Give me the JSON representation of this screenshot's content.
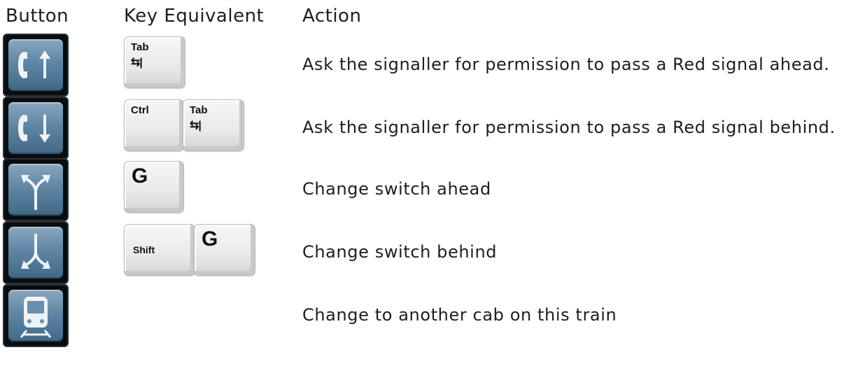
{
  "headers": {
    "button": "Button",
    "key_equivalent": "Key Equivalent",
    "action": "Action"
  },
  "rows": [
    {
      "icon": "phone-up-icon",
      "keys": [
        {
          "label": "Tab",
          "glyph": "⇆|"
        }
      ],
      "action": "Ask the signaller for permission to pass a Red signal ahead."
    },
    {
      "icon": "phone-down-icon",
      "keys": [
        {
          "label": "Ctrl"
        },
        {
          "label": "Tab",
          "glyph": "⇆|"
        }
      ],
      "action": "Ask the signaller for permission to pass a Red signal behind."
    },
    {
      "icon": "switch-ahead-icon",
      "keys": [
        {
          "label": "G"
        }
      ],
      "action": "Change switch ahead"
    },
    {
      "icon": "switch-behind-icon",
      "keys": [
        {
          "label": "Shift"
        },
        {
          "label": "G"
        }
      ],
      "action": "Change switch behind"
    },
    {
      "icon": "train-cab-icon",
      "keys": [],
      "action": "Change to another cab on this train"
    }
  ],
  "colors": {
    "button_face": "#5f86a5",
    "button_border": "#0a0d10",
    "key_face": "#e9e9e9",
    "text": "#1e1e1e"
  }
}
